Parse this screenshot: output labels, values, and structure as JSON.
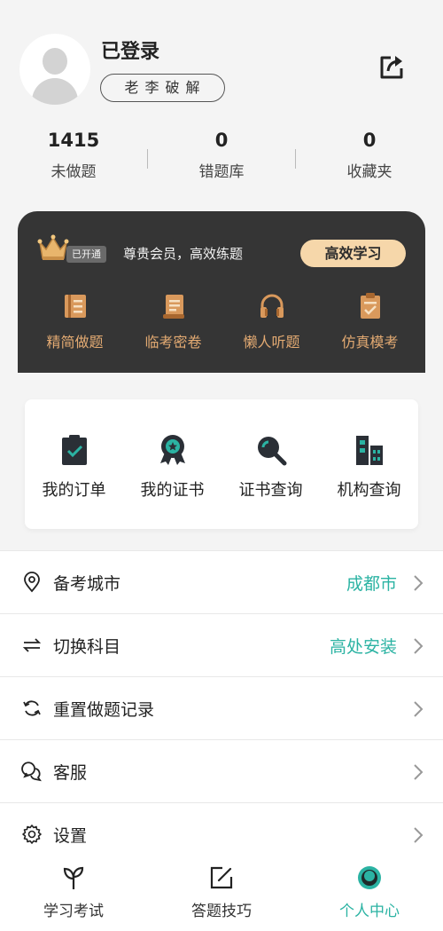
{
  "profile": {
    "username": "已登录",
    "nickname": "老李破解"
  },
  "stats": [
    {
      "value": "1415",
      "label": "未做题"
    },
    {
      "value": "0",
      "label": "错题库"
    },
    {
      "value": "0",
      "label": "收藏夹"
    }
  ],
  "vip": {
    "badge": "已开通",
    "description": "尊贵会员，高效练题",
    "cta": "高效学习",
    "items": [
      {
        "label": "精简做题",
        "icon": "book-icon"
      },
      {
        "label": "临考密卷",
        "icon": "scroll-icon"
      },
      {
        "label": "懒人听题",
        "icon": "headphones-icon"
      },
      {
        "label": "仿真模考",
        "icon": "clipboard-check-icon"
      }
    ],
    "accent": "#e3aa72"
  },
  "quick_actions": [
    {
      "label": "我的订单",
      "icon": "order-clipboard-icon"
    },
    {
      "label": "我的证书",
      "icon": "certificate-medal-icon"
    },
    {
      "label": "证书查询",
      "icon": "magnifier-icon"
    },
    {
      "label": "机构查询",
      "icon": "building-icon"
    }
  ],
  "menu": [
    {
      "label": "备考城市",
      "value": "成都市",
      "icon": "location-pin-icon"
    },
    {
      "label": "切换科目",
      "value": "高处安装",
      "icon": "swap-arrows-icon"
    },
    {
      "label": "重置做题记录",
      "value": "",
      "icon": "refresh-icon"
    },
    {
      "label": "客服",
      "value": "",
      "icon": "chat-bubble-icon"
    },
    {
      "label": "设置",
      "value": "",
      "icon": "gear-icon"
    }
  ],
  "tabs": [
    {
      "label": "学习考试",
      "icon": "sprout-icon",
      "active": false
    },
    {
      "label": "答题技巧",
      "icon": "edit-square-icon",
      "active": false
    },
    {
      "label": "个人中心",
      "icon": "user-center-icon",
      "active": true
    }
  ],
  "colors": {
    "teal": "#2bb3a3",
    "vip_bg": "#353535",
    "cta_bg": "#f6d7aa"
  }
}
